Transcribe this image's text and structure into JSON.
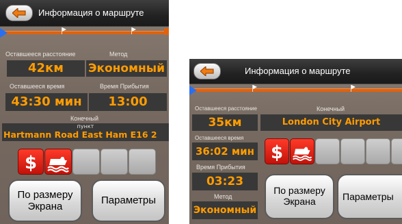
{
  "screen_a": {
    "title": "Информация о маршруте",
    "remaining_distance_label": "Оставшееся расстояние",
    "remaining_distance_value": "42км",
    "method_label": "Метод",
    "method_value": "Экономный",
    "remaining_time_label": "Оставшееся время",
    "remaining_time_value": "43:30 мин",
    "arrival_time_label": "Время Прибытия",
    "arrival_time_value": "13:00",
    "destination_label": "Конечный",
    "destination_sublabel": "пункт",
    "destination_value": "Hartmann Road East Ham E16 2",
    "fit_button_line1": "По размеру",
    "fit_button_line2": "Экрана",
    "params_button": "Параметры"
  },
  "screen_b": {
    "title": "Информация о маршруте",
    "remaining_distance_label": "Оставшееся расстояние",
    "remaining_distance_value": "35км",
    "destination_label": "Конечный",
    "destination_value": "London City Airport",
    "remaining_time_label": "Оставшееся время",
    "remaining_time_value": "36:02 мин",
    "arrival_time_label": "Время Прибытия",
    "arrival_time_value": "03:23",
    "method_label": "Метод",
    "method_value": "Экономный",
    "fit_button_line1": "По размеру",
    "fit_button_line2": "Экрана",
    "params_button": "Параметры"
  },
  "icons": [
    "back-arrow-icon",
    "toll-dollar-icon",
    "ferry-icon"
  ],
  "colors": {
    "accent": "#ff9c00",
    "route": "#e0620e",
    "restriction": "#e0261a"
  }
}
